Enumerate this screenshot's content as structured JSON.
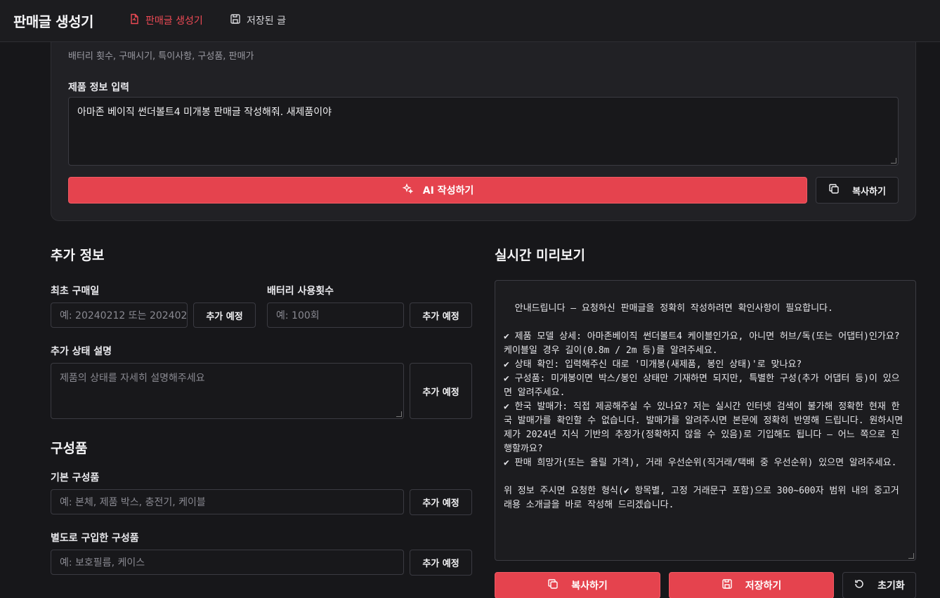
{
  "header": {
    "app_title": "판매글 생성기",
    "nav": [
      {
        "label": "판매글 생성기",
        "icon": "document-icon",
        "active": true
      },
      {
        "label": "저장된 글",
        "icon": "save-icon",
        "active": false
      }
    ]
  },
  "generator": {
    "hint": "배터리 횟수, 구매시기, 특이사항, 구성품, 판매가",
    "input_label": "제품 정보 입력",
    "input_value": "아마존 베이직 썬더볼트4 미개봉 판매글 작성해줘. 새제품이야",
    "generate_button": "AI 작성하기",
    "copy_button": "복사하기"
  },
  "extra_info": {
    "title": "추가 정보",
    "purchase_date": {
      "label": "최초 구매일",
      "placeholder": "예: 20240212 또는 202402",
      "button": "추가 예정"
    },
    "battery_count": {
      "label": "배터리 사용횟수",
      "placeholder": "예: 100회",
      "button": "추가 예정"
    },
    "condition": {
      "label": "추가 상태 설명",
      "placeholder": "제품의 상태를 자세히 설명해주세요",
      "button": "추가 예정"
    }
  },
  "components": {
    "title": "구성품",
    "basic": {
      "label": "기본 구성품",
      "placeholder": "예: 본체, 제품 박스, 충전기, 케이블",
      "button": "추가 예정"
    },
    "separate": {
      "label": "별도로 구입한 구성품",
      "placeholder": "예: 보호필름, 케이스",
      "button": "추가 예정"
    }
  },
  "preview": {
    "title": "실시간 미리보기",
    "content": "안내드립니다 — 요청하신 판매글을 정확히 작성하려면 확인사항이 필요합니다.\n\n✔ 제품 모델 상세: 아마존베이직 썬더볼트4 케이블인가요, 아니면 허브/독(또는 어댑터)인가요? 케이블일 경우 길이(0.8m / 2m 등)를 알려주세요.\n✔ 상태 확인: 입력해주신 대로 '미개봉(새제품, 봉인 상태)'로 맞나요?\n✔ 구성품: 미개봉이면 박스/봉인 상태만 기재하면 되지만, 특별한 구성(추가 어댑터 등)이 있으면 알려주세요.\n✔ 한국 발매가: 직접 제공해주실 수 있나요? 저는 실시간 인터넷 검색이 불가해 정확한 현재 한국 발매가를 확인할 수 없습니다. 발매가를 알려주시면 본문에 정확히 반영해 드립니다. 원하시면 제가 2024년 지식 기반의 추정가(정확하지 않을 수 있음)로 기입해도 됩니다 — 어느 쪽으로 진행할까요?\n✔ 판매 희망가(또는 올릴 가격), 거래 우선순위(직거래/택배 중 우선순위) 있으면 알려주세요.\n\n위 정보 주시면 요청한 형식(✔ 항목별, 고정 거래문구 포함)으로 300~600자 범위 내의 중고거래용 소개글을 바로 작성해 드리겠습니다.",
    "copy_button": "복사하기",
    "save_button": "저장하기",
    "reset_button": "초기화"
  }
}
